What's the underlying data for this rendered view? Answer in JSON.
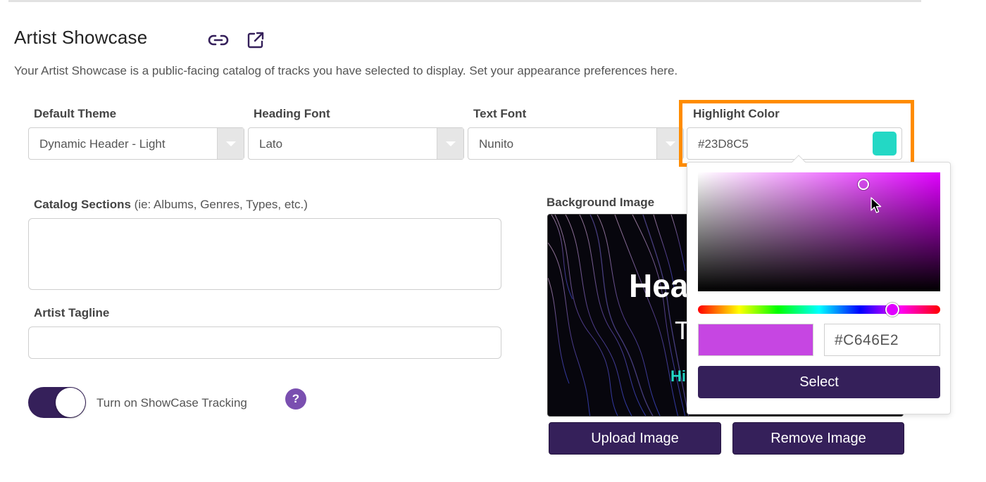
{
  "page": {
    "title": "Artist Showcase",
    "description": "Your Artist Showcase is a public-facing catalog of tracks you have selected to display. Set your appearance preferences here."
  },
  "fields": {
    "default_theme": {
      "label": "Default Theme",
      "value": "Dynamic Header - Light"
    },
    "heading_font": {
      "label": "Heading Font",
      "value": "Lato"
    },
    "text_font": {
      "label": "Text Font",
      "value": "Nunito"
    },
    "highlight_color": {
      "label": "Highlight Color",
      "value": "#23D8C5",
      "swatch_color": "#23D8C5"
    },
    "catalog_sections": {
      "label": "Catalog Sections",
      "hint": "(ie: Albums, Genres, Types, etc.)",
      "value": ""
    },
    "artist_tagline": {
      "label": "Artist Tagline",
      "value": ""
    }
  },
  "tracking": {
    "label": "Turn on ShowCase Tracking",
    "enabled": true,
    "help_symbol": "?"
  },
  "background_image": {
    "label": "Background Image",
    "preview_heading": "Hea",
    "preview_text": "T",
    "preview_highlight": "Hi",
    "upload_label": "Upload Image",
    "remove_label": "Remove Image"
  },
  "color_picker": {
    "hex_value": "#C646E2",
    "preview_color": "#C646E2",
    "hue_color": "#E000FF",
    "select_label": "Select"
  },
  "colors": {
    "accent": "#35205A",
    "focus_outline": "#FF8C00",
    "highlight": "#23D8C5",
    "help_badge": "#7A4FB0"
  },
  "icons": [
    "link-icon",
    "external-link-icon",
    "chevron-down-icon",
    "help-icon",
    "mouse-cursor-icon"
  ]
}
